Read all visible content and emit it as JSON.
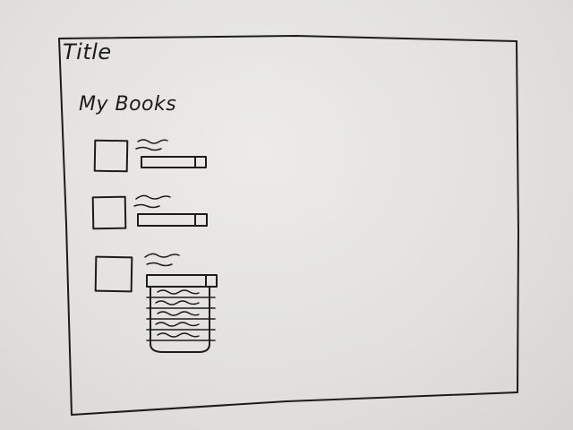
{
  "window": {
    "title": "Title"
  },
  "section": {
    "heading": "My Books"
  },
  "books": [
    {
      "checked": false,
      "dropdown_open": false
    },
    {
      "checked": false,
      "dropdown_open": false
    },
    {
      "checked": false,
      "dropdown_open": true,
      "option_count": 5
    }
  ],
  "colors": {
    "ink": "#1c1c1c",
    "paper": "#e6e5e2"
  }
}
